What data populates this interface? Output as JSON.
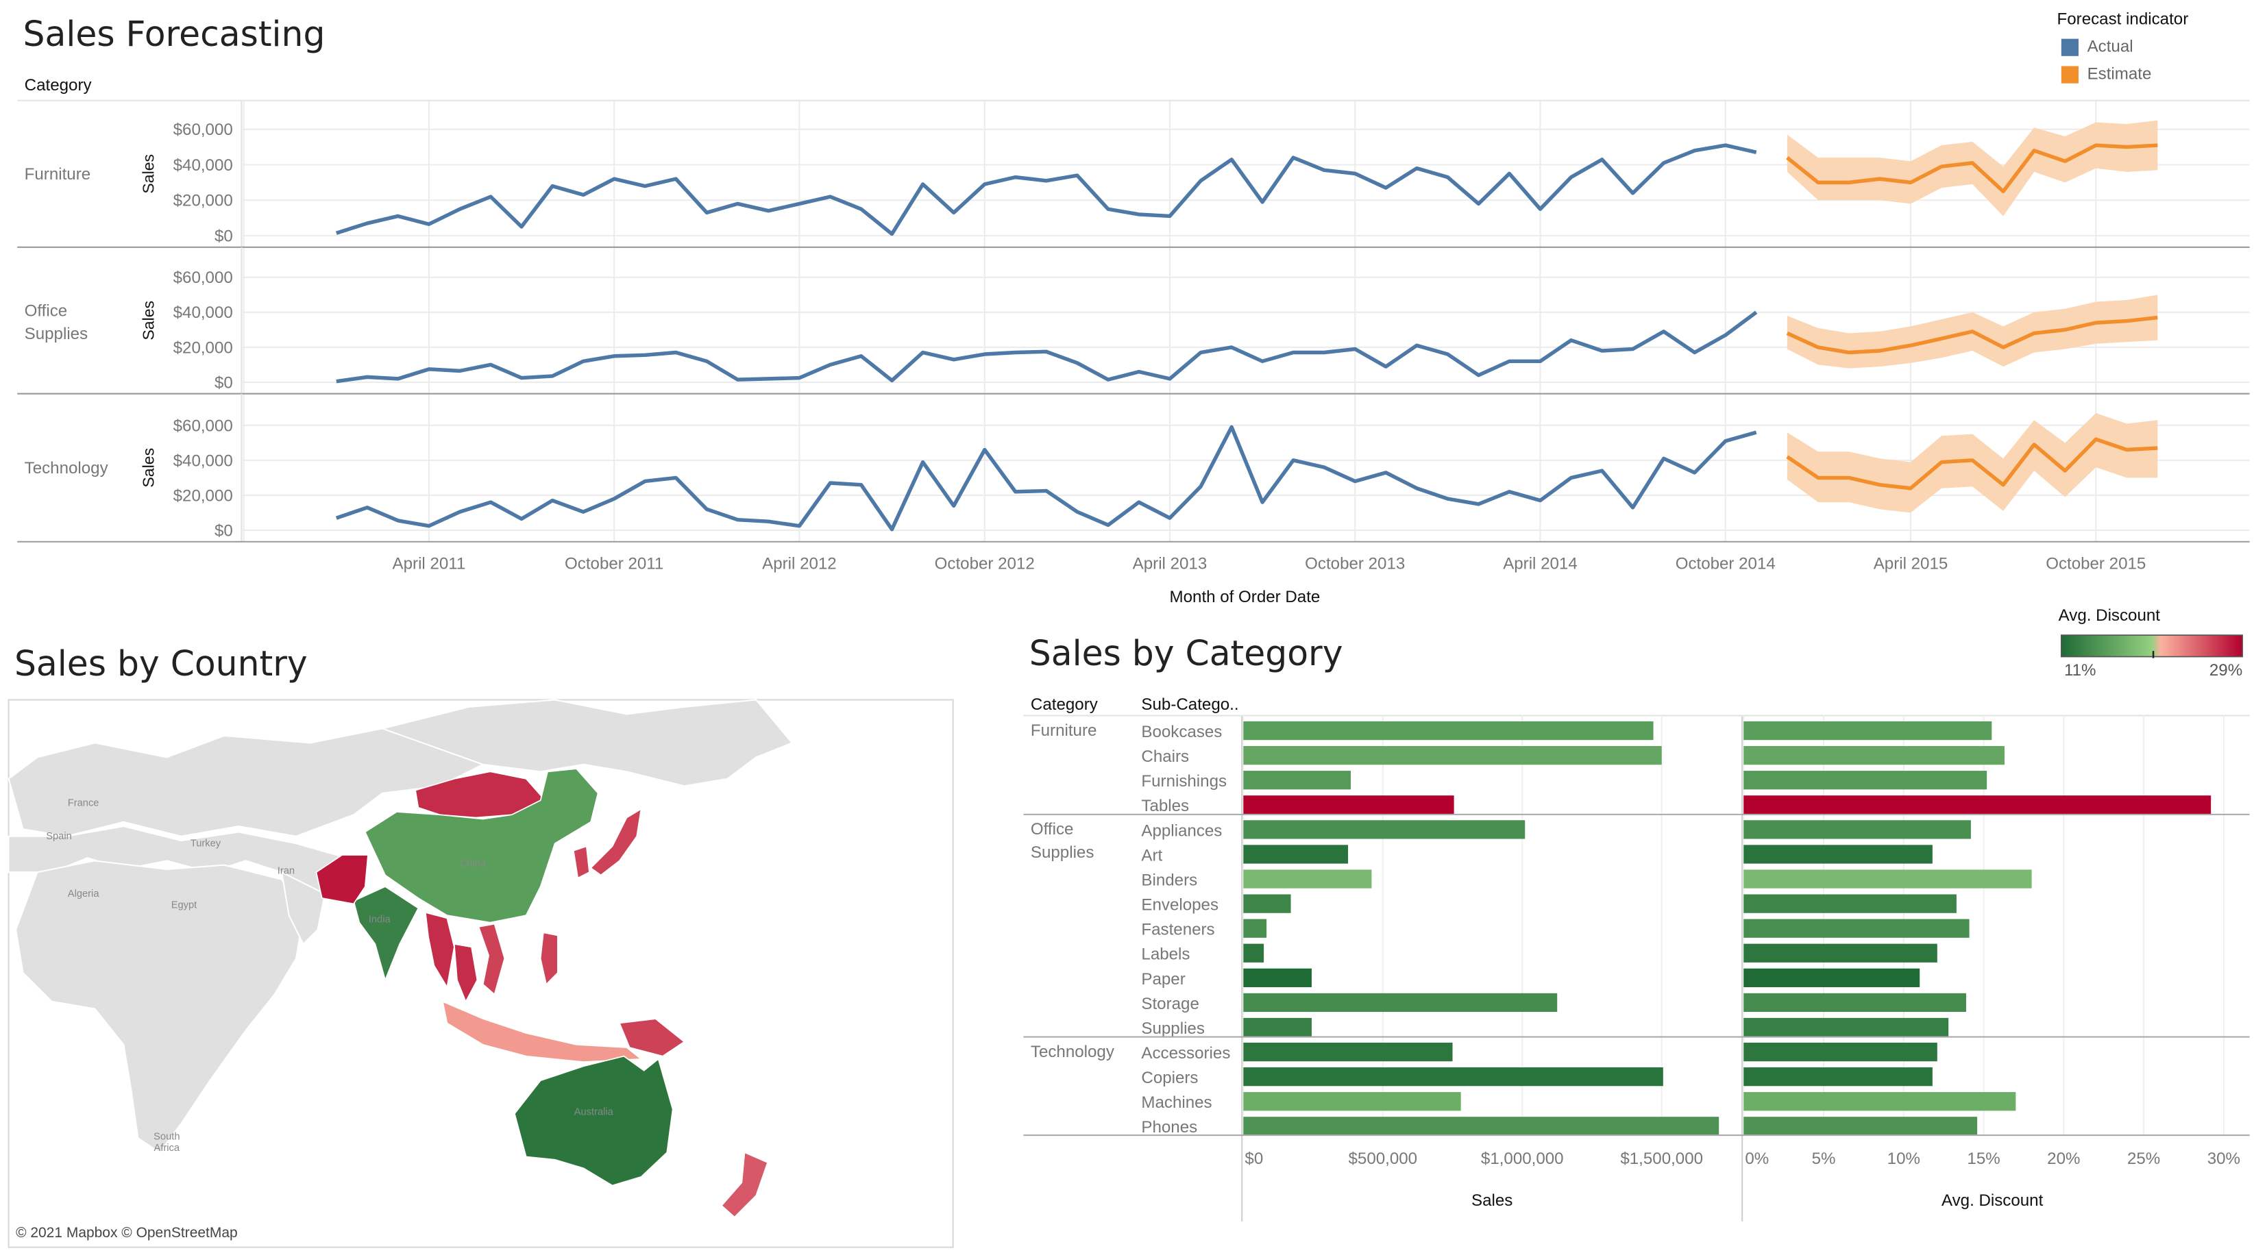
{
  "dashboard": {
    "forecast_title": "Sales Forecasting",
    "country_title": "Sales by Country",
    "category_title": "Sales by Category",
    "map_credit": "© 2021 Mapbox © OpenStreetMap"
  },
  "colors": {
    "actual": "#4e79a7",
    "estimate": "#f28e2b",
    "estimate_band": "#fbd6b4",
    "low_discount": "#1f6b36",
    "high_discount": "#b3002d",
    "grid": "#ececec",
    "map_land": "#e0e0e0"
  },
  "forecast_legend": {
    "title": "Forecast indicator",
    "items": [
      {
        "label": "Actual",
        "color": "#4e79a7"
      },
      {
        "label": "Estimate",
        "color": "#f28e2b"
      }
    ]
  },
  "discount_legend": {
    "title": "Avg. Discount",
    "min_label": "11%",
    "max_label": "29%"
  },
  "chart_data": [
    {
      "type": "line",
      "title": "Sales Forecasting",
      "xlabel": "Month of Order Date",
      "ylabel": "Sales",
      "row_header": "Category",
      "x_ticks": [
        "April 2011",
        "October 2011",
        "April 2012",
        "October 2012",
        "April 2013",
        "October 2013",
        "April 2014",
        "October 2014",
        "April 2015",
        "October 2015"
      ],
      "x_start": "January 2011",
      "y_ticks": [
        "$0",
        "$20,000",
        "$40,000",
        "$60,000"
      ],
      "ylim": [
        0,
        60000
      ],
      "panels": [
        {
          "category": "Furniture",
          "actual": [
            1500,
            7000,
            11000,
            6500,
            15000,
            22000,
            5000,
            28000,
            23000,
            32000,
            28000,
            32000,
            13000,
            18000,
            14000,
            18000,
            22000,
            15000,
            1000,
            29000,
            13000,
            29000,
            33000,
            31000,
            34000,
            15000,
            12000,
            11000,
            31000,
            43000,
            19000,
            44000,
            37000,
            35000,
            27000,
            38000,
            33000,
            18000,
            35000,
            15000,
            33000,
            43000,
            24000,
            41000,
            48000,
            51000,
            47000
          ],
          "estimate": [
            44000,
            30000,
            30000,
            32000,
            30000,
            39000,
            41000,
            25000,
            48000,
            42000,
            51000,
            50000,
            51000
          ],
          "estimate_low": [
            36000,
            20000,
            20000,
            20000,
            18000,
            27000,
            29000,
            11000,
            36000,
            30000,
            38000,
            36000,
            37000
          ],
          "estimate_high": [
            57000,
            44000,
            44000,
            44000,
            42000,
            51000,
            53000,
            39000,
            61000,
            56000,
            64000,
            63000,
            65000
          ]
        },
        {
          "category": "Office Supplies",
          "actual": [
            500,
            3000,
            2000,
            7500,
            6500,
            10000,
            2500,
            3500,
            12000,
            15000,
            15500,
            17000,
            12000,
            1500,
            2000,
            2500,
            10000,
            15000,
            1000,
            17000,
            13000,
            16000,
            17000,
            17500,
            11000,
            1500,
            6000,
            2000,
            17000,
            20000,
            12000,
            17000,
            17000,
            19000,
            9000,
            21000,
            16000,
            4000,
            12000,
            12000,
            24000,
            18000,
            19000,
            29000,
            17000,
            27000,
            40000
          ],
          "estimate": [
            28000,
            20000,
            17000,
            18000,
            21000,
            25000,
            29000,
            20000,
            28000,
            30000,
            34000,
            35000,
            37000
          ],
          "estimate_low": [
            19000,
            10000,
            8000,
            9000,
            11000,
            14000,
            18000,
            9000,
            17000,
            19000,
            22000,
            23000,
            24000
          ],
          "estimate_high": [
            38000,
            31000,
            28000,
            29000,
            32000,
            36000,
            40000,
            32000,
            40000,
            42000,
            46000,
            47000,
            50000
          ]
        },
        {
          "category": "Technology",
          "actual": [
            7000,
            13000,
            5500,
            2500,
            10500,
            16000,
            6500,
            17000,
            10500,
            18000,
            28000,
            30000,
            12000,
            6000,
            5000,
            2500,
            27000,
            26000,
            500,
            39000,
            14000,
            46000,
            22000,
            22500,
            10500,
            3000,
            16000,
            7000,
            25000,
            59000,
            16000,
            40000,
            36000,
            28000,
            33000,
            24000,
            18000,
            15000,
            22000,
            17000,
            30000,
            34000,
            13000,
            41000,
            33000,
            51000,
            56000
          ],
          "estimate": [
            42000,
            30000,
            30000,
            26000,
            24000,
            39000,
            40000,
            26000,
            49000,
            34000,
            52000,
            46000,
            47000
          ],
          "estimate_low": [
            29000,
            16000,
            16000,
            12000,
            10000,
            24000,
            25000,
            11000,
            34000,
            19000,
            36000,
            30000,
            30000
          ],
          "estimate_high": [
            56000,
            45000,
            45000,
            41000,
            39000,
            54000,
            55000,
            41000,
            63000,
            50000,
            67000,
            61000,
            63000
          ]
        }
      ]
    },
    {
      "type": "bar",
      "title": "Sales by Category",
      "xlabel": "Sales",
      "col_headers": [
        "Category",
        "Sub-Catego.."
      ],
      "x_ticks": [
        "$0",
        "$500,000",
        "$1,000,000",
        "$1,500,000"
      ],
      "xlim": [
        0,
        1800000
      ],
      "groups": [
        {
          "category": "Furniture",
          "rows": [
            {
              "sub": "Bookcases",
              "sales": 1470000,
              "discount": 0.155
            },
            {
              "sub": "Chairs",
              "sales": 1500000,
              "discount": 0.163
            },
            {
              "sub": "Furnishings",
              "sales": 385000,
              "discount": 0.152
            },
            {
              "sub": "Tables",
              "sales": 755000,
              "discount": 0.292
            }
          ]
        },
        {
          "category": "Office Supplies",
          "rows": [
            {
              "sub": "Appliances",
              "sales": 1010000,
              "discount": 0.142
            },
            {
              "sub": "Art",
              "sales": 375000,
              "discount": 0.118
            },
            {
              "sub": "Binders",
              "sales": 460000,
              "discount": 0.18
            },
            {
              "sub": "Envelopes",
              "sales": 170000,
              "discount": 0.133
            },
            {
              "sub": "Fasteners",
              "sales": 83000,
              "discount": 0.141
            },
            {
              "sub": "Labels",
              "sales": 73000,
              "discount": 0.121
            },
            {
              "sub": "Paper",
              "sales": 245000,
              "discount": 0.11
            },
            {
              "sub": "Storage",
              "sales": 1125000,
              "discount": 0.139
            },
            {
              "sub": "Supplies",
              "sales": 245000,
              "discount": 0.128
            }
          ]
        },
        {
          "category": "Technology",
          "rows": [
            {
              "sub": "Accessories",
              "sales": 750000,
              "discount": 0.121
            },
            {
              "sub": "Copiers",
              "sales": 1505000,
              "discount": 0.118
            },
            {
              "sub": "Machines",
              "sales": 780000,
              "discount": 0.17
            },
            {
              "sub": "Phones",
              "sales": 1705000,
              "discount": 0.146
            }
          ]
        }
      ]
    },
    {
      "type": "bar",
      "xlabel": "Avg. Discount",
      "x_ticks": [
        "0%",
        "5%",
        "10%",
        "15%",
        "20%",
        "25%",
        "30%"
      ],
      "xlim": [
        0,
        0.3
      ],
      "value_key": "discount"
    }
  ],
  "map": {
    "country_labels": [
      "France",
      "Spain",
      "Turkey",
      "Algeria",
      "Egypt",
      "Iran",
      "China",
      "India",
      "Australia",
      "South Africa"
    ],
    "regions": [
      {
        "name": "Mongolia",
        "discount": 0.27
      },
      {
        "name": "China",
        "discount": 0.155
      },
      {
        "name": "Japan",
        "discount": 0.26
      },
      {
        "name": "Korea",
        "discount": 0.26
      },
      {
        "name": "India",
        "discount": 0.13
      },
      {
        "name": "Pakistan",
        "discount": 0.28
      },
      {
        "name": "Myanmar",
        "discount": 0.27
      },
      {
        "name": "Thailand",
        "discount": 0.27
      },
      {
        "name": "Vietnam",
        "discount": 0.26
      },
      {
        "name": "Philippines",
        "discount": 0.26
      },
      {
        "name": "Indonesia",
        "discount": 0.22
      },
      {
        "name": "Papua New Guinea",
        "discount": 0.26
      },
      {
        "name": "Australia",
        "discount": 0.12
      },
      {
        "name": "New Zealand",
        "discount": 0.25
      }
    ]
  }
}
